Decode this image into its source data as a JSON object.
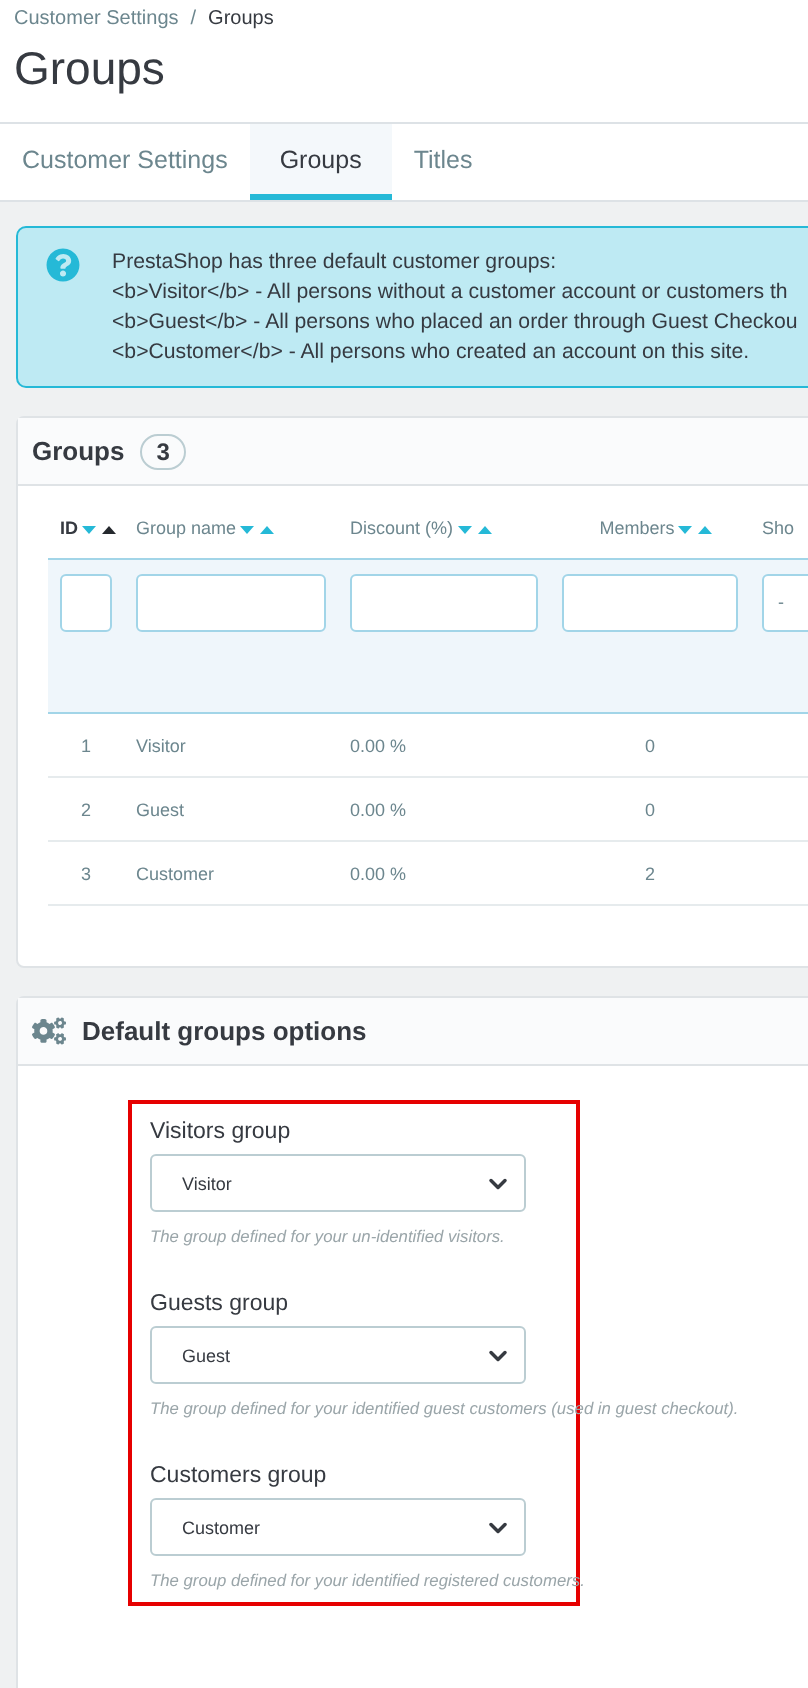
{
  "breadcrumb": [
    {
      "label": "Customer Settings"
    },
    {
      "label": "/"
    },
    {
      "label": "Groups"
    }
  ],
  "title": "Groups",
  "tabs": [
    {
      "label": "Customer Settings",
      "selected": false
    },
    {
      "label": "Groups",
      "selected": true
    },
    {
      "label": "Titles",
      "selected": false
    }
  ],
  "alert": {
    "lines": [
      "PrestaShop has three default customer groups:",
      "<b>Visitor</b> - All persons without a customer account or customers th",
      "<b>Guest</b> - All persons who placed an order through Guest Checkou",
      "<b>Customer</b> - All persons who created an account on this site."
    ]
  },
  "groups_panel": {
    "title": "Groups",
    "count": "3",
    "columns": [
      {
        "label": "ID",
        "sort_active": true
      },
      {
        "label": "Group name",
        "sort_active": false
      },
      {
        "label": "Discount (%)",
        "sort_active": false
      },
      {
        "label": "Members",
        "sort_active": false
      },
      {
        "label": "Sho",
        "filter_value": "-"
      }
    ],
    "rows": [
      [
        "1",
        "Visitor",
        "0.00 %",
        "0"
      ],
      [
        "2",
        "Guest",
        "0.00 %",
        "0"
      ],
      [
        "3",
        "Customer",
        "0.00 %",
        "2"
      ]
    ]
  },
  "options_panel": {
    "title": "Default groups options",
    "fields": [
      {
        "label": "Visitors group",
        "value": "Visitor",
        "hint": "The group defined for your un-identified visitors."
      },
      {
        "label": "Guests group",
        "value": "Guest",
        "hint": "The group defined for your identified guest customers (used in guest checkout)."
      },
      {
        "label": "Customers group",
        "value": "Customer",
        "hint": "The group defined for your identified registered customers."
      }
    ]
  }
}
